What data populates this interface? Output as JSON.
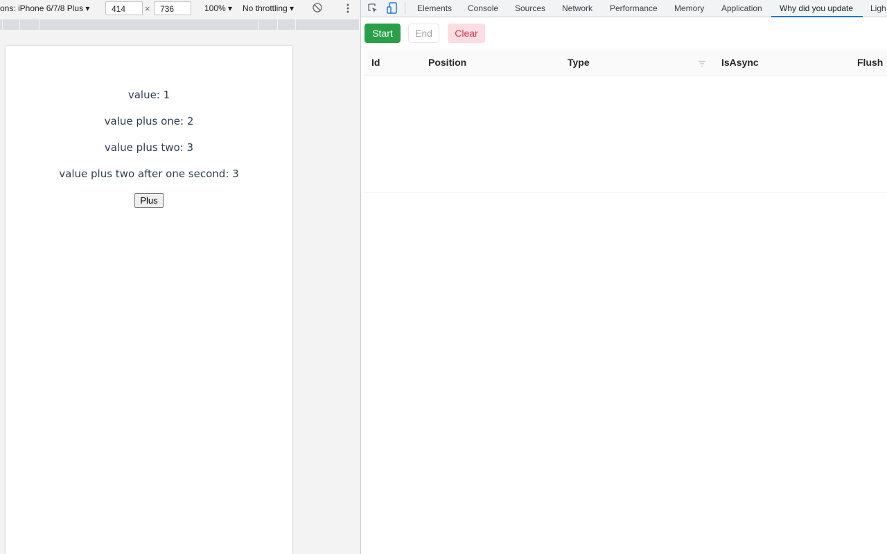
{
  "device_toolbar": {
    "dimensions_label": "ons: iPhone 6/7/8 Plus ▾",
    "width": "414",
    "times": "×",
    "height": "736",
    "zoom": "100% ▾",
    "throttling": "No throttling ▾",
    "rotate_icon": "rotate-icon",
    "more_icon": "kebab-icon"
  },
  "page": {
    "value_line": "value: 1",
    "plus_one_line": "value plus one: 2",
    "plus_two_line": "value plus two: 3",
    "plus_two_delayed_line": "value plus two after one second: 3",
    "plus_button": "Plus"
  },
  "devtools": {
    "tabs": [
      {
        "label": "Elements"
      },
      {
        "label": "Console"
      },
      {
        "label": "Sources"
      },
      {
        "label": "Network"
      },
      {
        "label": "Performance"
      },
      {
        "label": "Memory"
      },
      {
        "label": "Application"
      },
      {
        "label": "Why did you update",
        "active": true
      },
      {
        "label": "Ligh"
      }
    ],
    "accent_color": "#1a73e8"
  },
  "panel": {
    "buttons": {
      "start": "Start",
      "end": "End",
      "clear": "Clear"
    },
    "colors": {
      "start": "#28a047",
      "clear_bg": "#fbdde2",
      "clear_text": "#d4364c"
    },
    "table": {
      "columns": [
        "Id",
        "Position",
        "Type",
        "IsAsync",
        "Flush"
      ],
      "rows": []
    }
  }
}
